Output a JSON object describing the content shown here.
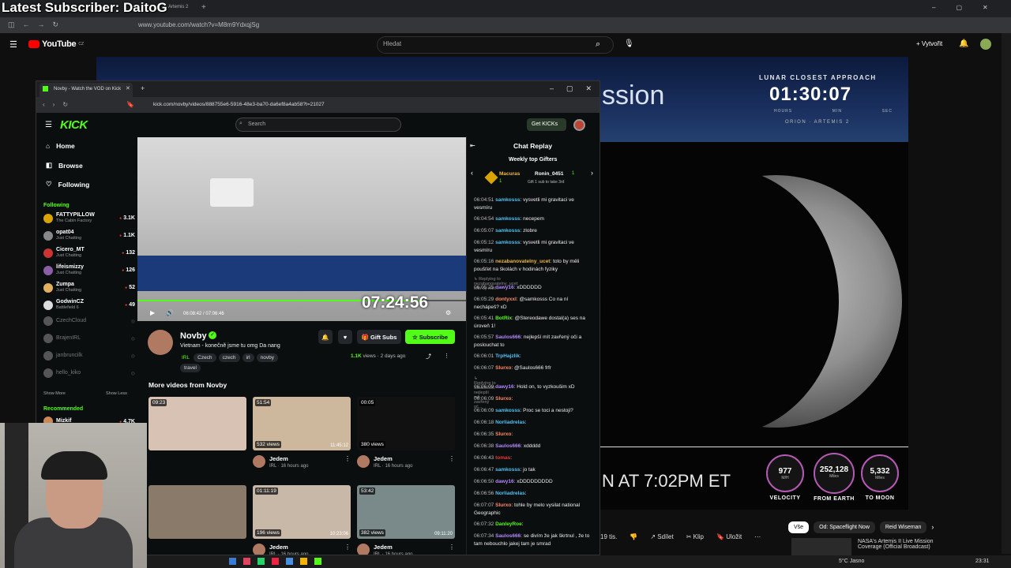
{
  "overlay": {
    "subscriber_text": "Latest Subscriber: DaitoG"
  },
  "outer_browser": {
    "tab_title": "Artemis 2",
    "url": "www.youtube.com/watch?v=M8m9YdxqjSg"
  },
  "youtube": {
    "logo": "YouTube",
    "logo_suffix": "CZ",
    "search_placeholder": "Hledat",
    "create_label": "Vytvořit",
    "mission_text": "ssion",
    "lunar_title": "LUNAR CLOSEST APPROACH",
    "lunar_time": "01:30:07",
    "lunar_labels": [
      "HOURS",
      "MIN",
      "SEC"
    ],
    "lunar_sub": "ORION · ARTEMIS 2",
    "countdown_text": "N AT 7:02PM ET",
    "gauges": [
      {
        "value": "977",
        "unit": "M/H",
        "label": "VELOCITY"
      },
      {
        "value": "252,128",
        "unit": "Miles",
        "label": "FROM EARTH"
      },
      {
        "value": "5,332",
        "unit": "Miles",
        "label": "TO MOON"
      }
    ],
    "actions": [
      "19 tis.",
      "Sdílet",
      "Klip",
      "Uložit"
    ],
    "chips": [
      "Vše",
      "Od: Spaceflight Now",
      "Reid Wiseman"
    ],
    "rec_title": "NASA's Artemis II Live Mission Coverage (Official Broadcast)"
  },
  "taskbar": {
    "weather": "5°C Jasno",
    "time": "23:31"
  },
  "kick_window": {
    "tab_title": "Novby - Watch the VOD on Kick",
    "url": "kick.com/novby/videos/888755e6-5916-48e3-ba70-da6ef8a4ab58?t=21027",
    "logo": "KICK",
    "search_placeholder": "Search",
    "get_kicks": "Get KICKs",
    "nav": {
      "home": "Home",
      "browse": "Browse",
      "following": "Following"
    },
    "following_heading": "Following",
    "channels": [
      {
        "name": "FATTYPILLOW",
        "sub": "The Cabin Factory",
        "count": "3.1K",
        "color": "#d9a400",
        "live": true
      },
      {
        "name": "opat04",
        "sub": "Just Chatting",
        "count": "1.1K",
        "color": "#888",
        "live": true
      },
      {
        "name": "Cicero_MT",
        "sub": "Just Chatting",
        "count": "132",
        "color": "#c33",
        "live": true
      },
      {
        "name": "lifeismizzy",
        "sub": "Just Chatting",
        "count": "126",
        "color": "#8a5fa8",
        "live": true
      },
      {
        "name": "Zumpa",
        "sub": "Just Chatting",
        "count": "52",
        "color": "#e0b060",
        "live": true
      },
      {
        "name": "GodwinCZ",
        "sub": "Battlefield 6",
        "count": "49",
        "color": "#ddd",
        "live": true
      },
      {
        "name": "CzechCloud",
        "sub": "",
        "count": "",
        "color": "#555",
        "live": false
      },
      {
        "name": "BrajenIRL",
        "sub": "",
        "count": "",
        "color": "#555",
        "live": false
      },
      {
        "name": "janbruncilk",
        "sub": "",
        "count": "",
        "color": "#555",
        "live": false
      },
      {
        "name": "hello_kiko",
        "sub": "",
        "count": "",
        "color": "#555",
        "live": false
      }
    ],
    "show_more": "Show More",
    "show_less": "Show Less",
    "recommended_heading": "Recommended",
    "recommended": [
      {
        "name": "Mizkif",
        "count": "4.7K"
      }
    ],
    "player": {
      "timestamp_overlay": "07:24:56",
      "time": "06:08:42 / 07:06:46",
      "progress": 0.86
    },
    "channel": {
      "name": "Novby",
      "title": "Vietnam - konečně jsme tu omg Da nang",
      "category": "IRL",
      "tags": [
        "Czech",
        "czech",
        "irl",
        "novby"
      ],
      "extra_tag": "travel",
      "views": "1.1K",
      "views_suffix": "views",
      "age": "2 days ago",
      "gift_subs": "Gift Subs",
      "subscribe": "Subscribe"
    },
    "more_videos_title": "More videos from Novby",
    "videos": [
      {
        "duration": "09:23",
        "views": "",
        "stamp": "",
        "channel": "",
        "sub": ""
      },
      {
        "duration": "51:54",
        "views": "532 views",
        "stamp": "11:45:12",
        "channel": "Jedem",
        "sub": "IRL · 16 hours ago"
      },
      {
        "duration": "00:05",
        "views": "380 views",
        "stamp": "",
        "channel": "Jedem",
        "sub": "IRL · 16 hours ago"
      },
      {
        "duration": "",
        "views": "",
        "stamp": "",
        "channel": "",
        "sub": ""
      },
      {
        "duration": "01:11:19",
        "views": "196 views",
        "stamp": "10:23:06",
        "channel": "Jedem",
        "sub": "IRL · 16 hours ago"
      },
      {
        "duration": "53:42",
        "views": "382 views",
        "stamp": "09:11:20",
        "channel": "Jedem",
        "sub": "IRL · 16 hours ago"
      }
    ],
    "chat": {
      "title": "Chat Replay",
      "gifters_title": "Weekly top Gifters",
      "gifter1": "Macuras",
      "gifter1_count": "1",
      "gifter2": "Ronin_0451",
      "gifter2_count": "1",
      "gifter_note": "Gift 1 sub to take 3rd",
      "messages": [
        {
          "time": "06:04:51",
          "user": "samkosss",
          "color": "#4fc3f7",
          "text": "vysvetli mi gravitaci ve vesmíru"
        },
        {
          "time": "06:04:54",
          "user": "samkosss",
          "color": "#4fc3f7",
          "text": "necepem"
        },
        {
          "time": "06:05:07",
          "user": "samkosss",
          "color": "#4fc3f7",
          "text": "zlobre"
        },
        {
          "time": "06:05:12",
          "user": "samkosss",
          "color": "#4fc3f7",
          "text": "vysvetli mi gravitaci ve vesmíru"
        },
        {
          "time": "06:05:16",
          "user": "nezabanovatelny_ucet",
          "color": "#f0b840",
          "text": "toto by měli poušťet na školách v hodinách fyziky"
        },
        {
          "time": "",
          "user": "",
          "color": "#888",
          "text": "Replying to nezabanovatelny_ucet: toto by měl...",
          "reply": true
        },
        {
          "time": "06:05:25",
          "user": "dawy16",
          "color": "#b388ff",
          "text": "xDDDDDD"
        },
        {
          "time": "06:05:29",
          "user": "dontyxxl",
          "color": "#ff8a65",
          "text": "@samkosss Co na ní nechápeš? xD"
        },
        {
          "time": "06:05:41",
          "user": "BotRix",
          "color": "#53fc18",
          "text": "@Stereodawe dostal(a) ses na úroveň 1!"
        },
        {
          "time": "06:05:57",
          "user": "Saulos666",
          "color": "#b388ff",
          "text": "nejlepší mít zavřený oči a poslouchat to"
        },
        {
          "time": "06:06:01",
          "user": "TrpHajzlik",
          "color": "#4fc3f7",
          "text": ""
        },
        {
          "time": "06:06:07",
          "user": "Slurxo",
          "color": "#ff8a65",
          "text": "@Saulos666 frfr"
        },
        {
          "time": "",
          "user": "",
          "color": "#888",
          "text": "Replying to Saulos666: nejlepší mít zavřený oč...",
          "reply": true
        },
        {
          "time": "06:06:09",
          "user": "dawy16",
          "color": "#b388ff",
          "text": "Hold on, to vyzkoušim xD"
        },
        {
          "time": "06:06:09",
          "user": "Slurxo",
          "color": "#ff8a65",
          "text": ""
        },
        {
          "time": "06:06:09",
          "user": "samkosss",
          "color": "#4fc3f7",
          "text": "Proc se toci a nestoji?"
        },
        {
          "time": "06:06:18",
          "user": "Norliadrelas",
          "color": "#4fc3f7",
          "text": ""
        },
        {
          "time": "06:06:35",
          "user": "Slurxo",
          "color": "#ff8a65",
          "text": ""
        },
        {
          "time": "06:06:38",
          "user": "Saulos666",
          "color": "#b388ff",
          "text": "xddddd"
        },
        {
          "time": "06:06:43",
          "user": "tomas",
          "color": "#e63b3b",
          "text": ""
        },
        {
          "time": "06:06:47",
          "user": "samkosss",
          "color": "#4fc3f7",
          "text": "jo tak"
        },
        {
          "time": "06:06:50",
          "user": "dawy16",
          "color": "#b388ff",
          "text": "xDDDDDDDDD"
        },
        {
          "time": "06:06:56",
          "user": "Norliadrelas",
          "color": "#4fc3f7",
          "text": ""
        },
        {
          "time": "06:07:07",
          "user": "Slurxo",
          "color": "#ff8a65",
          "text": "tohle by melo vysilat national Geographic"
        },
        {
          "time": "06:07:32",
          "user": "DanleyRoe",
          "color": "#53fc18",
          "text": ""
        },
        {
          "time": "06:07:34",
          "user": "Saulos666",
          "color": "#b388ff",
          "text": "se divím že jak škrtnul , že to tam nebouchlo jakej tam je smrad"
        }
      ]
    }
  }
}
